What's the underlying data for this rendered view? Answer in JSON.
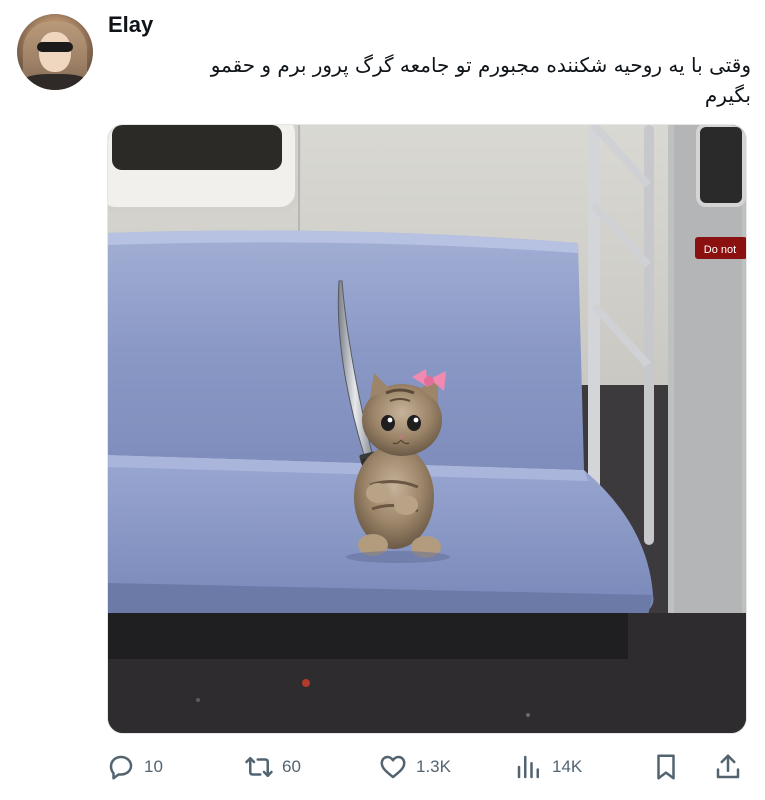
{
  "tweet": {
    "author_name": "Elay",
    "text": "وقتی با یه روحیه شکننده مجبورم تو جامعه گرگ پرور برم و حقمو\nبگیرم",
    "media": {
      "alt_icon": "kitten-with-sword-photo",
      "sign_text": "Do not"
    }
  },
  "actions": {
    "reply": {
      "icon": "reply-icon",
      "count": "10"
    },
    "retweet": {
      "icon": "retweet-icon",
      "count": "60"
    },
    "like": {
      "icon": "heart-icon",
      "count": "1.3K"
    },
    "views": {
      "icon": "views-icon",
      "count": "14K"
    },
    "bookmark": {
      "icon": "bookmark-icon"
    },
    "share": {
      "icon": "share-icon"
    }
  },
  "colors": {
    "text_primary": "#0f1419",
    "text_secondary": "#536471",
    "bench": "#8e9cc8",
    "bow": "#f08ab0"
  }
}
